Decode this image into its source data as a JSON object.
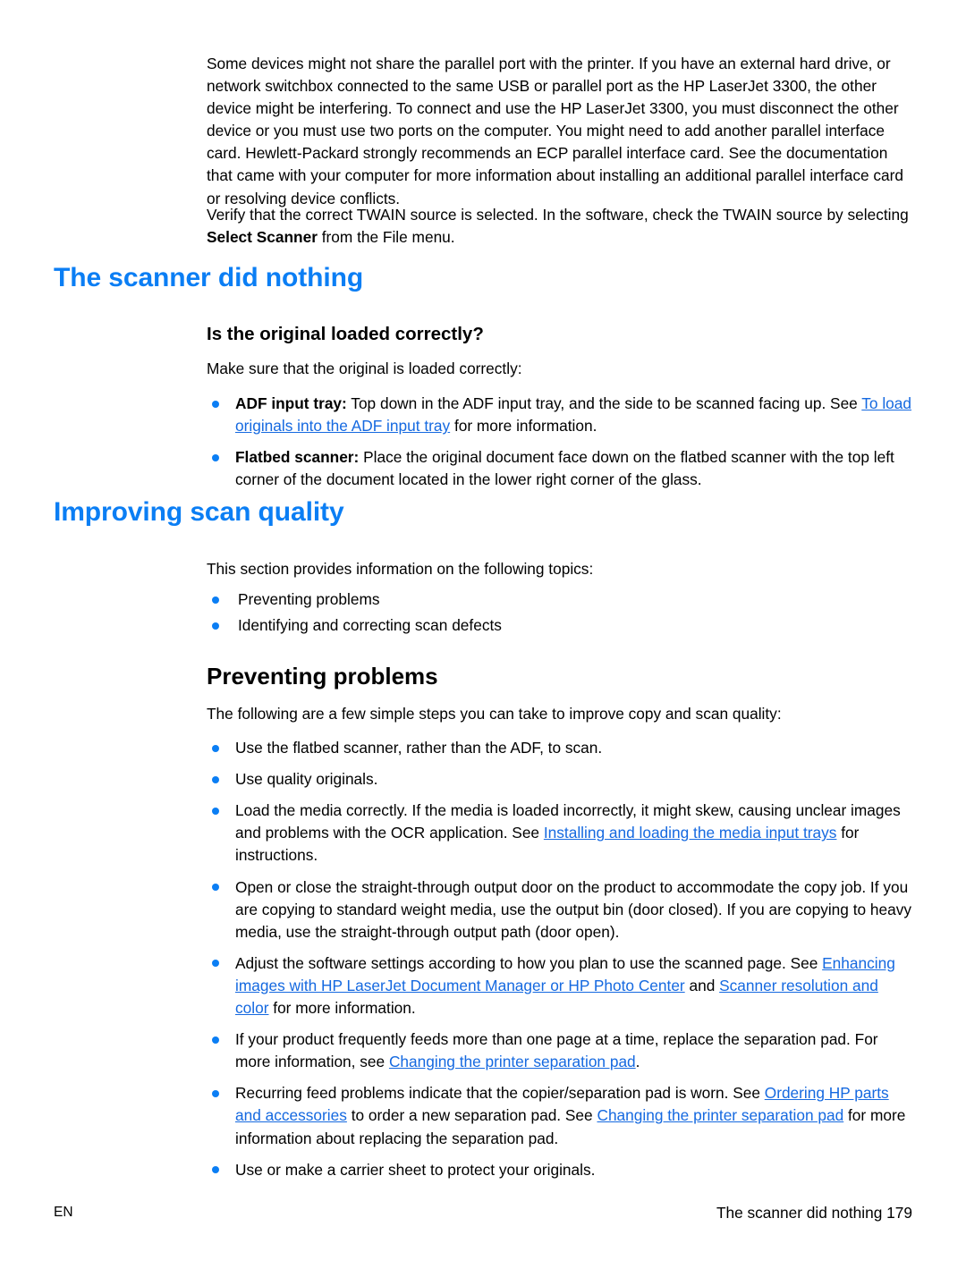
{
  "page": {
    "language_code": "EN",
    "footer_title": "The scanner did nothing",
    "page_number": "179",
    "footer_right": "The scanner did nothing 179",
    "accent_blue": "#0b7ef4",
    "link_blue": "#1569e0",
    "text_black": "#000000",
    "background": "#ffffff"
  },
  "intro": {
    "paragraph_1": "Some devices might not share the parallel port with the printer. If you have an external hard drive, or network switchbox connected to the same USB or parallel port as the HP LaserJet 3300, the other device might be interfering. To connect and use the HP LaserJet 3300, you must disconnect the other device or you must use two ports on the computer. You might need to add another parallel interface card. Hewlett-Packard strongly recommends an ECP parallel interface card. See the documentation that came with your computer for more information about installing an additional parallel interface card or resolving device conflicts.",
    "paragraph_2_a": "Verify that the correct TWAIN source is selected. In the software, check the TWAIN source by selecting ",
    "paragraph_2_bold": "Select Scanner",
    "paragraph_2_b": " from the File menu."
  },
  "section_scanner_nothing": {
    "heading": "The scanner did nothing",
    "subheading": "Is the original loaded correctly?",
    "lead": "Make sure that the original is loaded correctly:",
    "bullets": {
      "adf_label": "ADF input tray:",
      "adf_text_a": " Top down in the ADF input tray, and the side to be scanned facing up. See ",
      "adf_link": "To load originals into the ADF input tray",
      "adf_text_b": " for more information.",
      "flatbed_label": "Flatbed scanner:",
      "flatbed_text": " Place the original document face down on the flatbed scanner with the top left corner of the document located in the lower right corner of the glass."
    }
  },
  "section_improving": {
    "heading": "Improving scan quality",
    "lead": "This section provides information on the following topics:",
    "topics": [
      "Preventing problems",
      "Identifying and correcting scan defects"
    ]
  },
  "section_preventing": {
    "heading": "Preventing problems",
    "lead": "The following are a few simple steps you can take to improve copy and scan quality:",
    "bullets": {
      "b1": "Use the flatbed scanner, rather than the ADF, to scan.",
      "b2": "Use quality originals.",
      "b3_a": "Load the media correctly. If the media is loaded incorrectly, it might skew, causing unclear images and problems with the OCR application. See ",
      "b3_link": "Installing and loading the media input trays",
      "b3_b": " for instructions.",
      "b4": "Open or close the straight-through output door on the product to accommodate the copy job. If you are copying to standard weight media, use the output bin (door closed). If you are copying to heavy media, use the straight-through output path (door open).",
      "b5_a": "Adjust the software settings according to how you plan to use the scanned page. See ",
      "b5_link1": "Enhancing images with HP LaserJet Document Manager or HP Photo Center",
      "b5_mid": " and ",
      "b5_link2": "Scanner resolution and color",
      "b5_b": " for more information.",
      "b6_a": "If your product frequently feeds more than one page at a time, replace the separation pad. For more information, see ",
      "b6_link": "Changing the printer separation pad",
      "b6_b": ".",
      "b7_a": "Recurring feed problems indicate that the copier/separation pad is worn. See ",
      "b7_link1": "Ordering HP parts and accessories",
      "b7_mid": " to order a new separation pad. See ",
      "b7_link2": "Changing the printer separation pad",
      "b7_b": " for more information about replacing the separation pad.",
      "b8": "Use or make a carrier sheet to protect your originals."
    }
  }
}
